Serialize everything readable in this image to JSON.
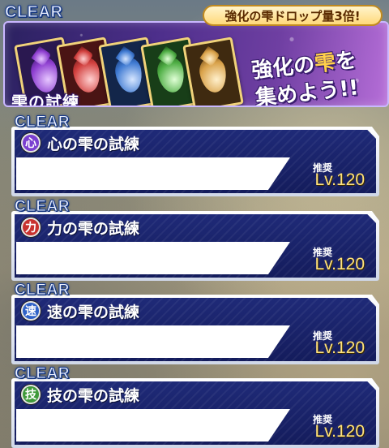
{
  "banner": {
    "clear_label": "CLEAR",
    "drop_badge": "強化の雫ドロップ量3倍!",
    "logo_text": "雫の試練",
    "slogan_line1_pre": "強化の",
    "slogan_line1_accent": "雫",
    "slogan_line1_post": "を",
    "slogan_line2": "集めよう!!",
    "card_colors": [
      "#8e3fd0",
      "#d2413f",
      "#3f7ad2",
      "#4fae45",
      "#d9a24a"
    ]
  },
  "quests": [
    {
      "clear_label": "CLEAR",
      "icon_char": "心",
      "icon_color": "#7a3fd0",
      "title": "心の雫の試練",
      "rec_label": "推奨",
      "rec_level": "Lv.120"
    },
    {
      "clear_label": "CLEAR",
      "icon_char": "力",
      "icon_color": "#c8322f",
      "title": "力の雫の試練",
      "rec_label": "推奨",
      "rec_level": "Lv.120"
    },
    {
      "clear_label": "CLEAR",
      "icon_char": "速",
      "icon_color": "#2f62c8",
      "title": "速の雫の試練",
      "rec_label": "推奨",
      "rec_level": "Lv.120"
    },
    {
      "clear_label": "CLEAR",
      "icon_char": "技",
      "icon_color": "#3f9a3a",
      "title": "技の雫の試練",
      "rec_label": "推奨",
      "rec_level": "Lv.120"
    }
  ]
}
